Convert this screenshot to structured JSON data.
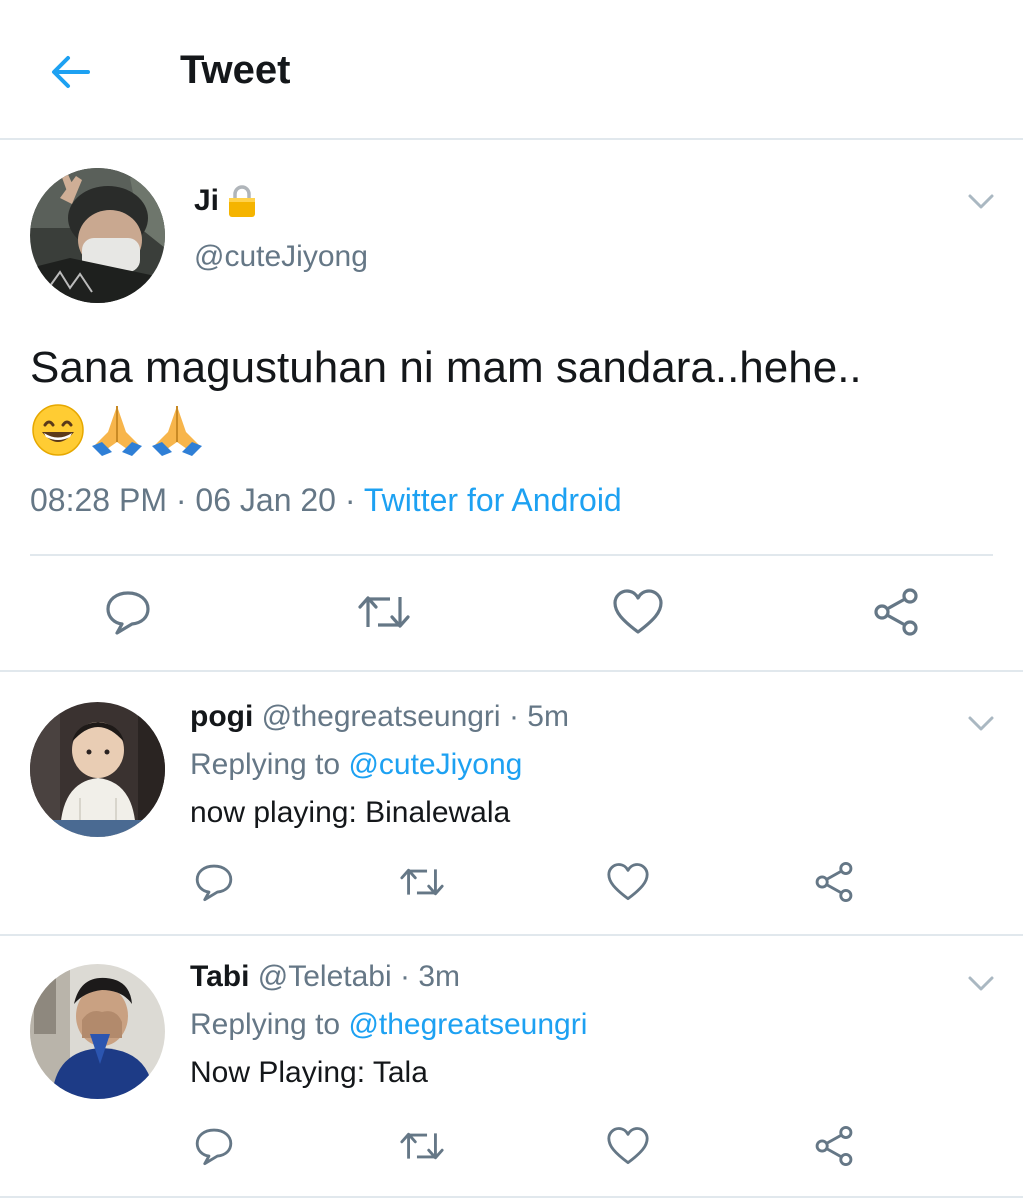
{
  "header": {
    "title": "Tweet",
    "back_icon": "arrow-left-icon"
  },
  "main_tweet": {
    "name": "Ji",
    "name_badge_icon": "lock-icon",
    "handle": "@cuteJiyong",
    "text": "Sana magustuhan ni mam sandara..hehe..",
    "emojis": [
      "grinning-face-emoji",
      "folded-hands-emoji",
      "folded-hands-emoji"
    ],
    "time": "08:28 PM",
    "date": "06 Jan 20",
    "separator": " · ",
    "source": "Twitter for Android",
    "actions": [
      "reply-icon",
      "retweet-icon",
      "like-icon",
      "share-icon"
    ]
  },
  "replies": [
    {
      "name": "pogi",
      "handle": "@thegreatseungri",
      "time": "5m",
      "replying_label": "Replying to",
      "replying_to": "@cuteJiyong",
      "text": "now playing: Binalewala"
    },
    {
      "name": "Tabi",
      "handle": "@Teletabi",
      "time": "3m",
      "replying_label": "Replying to",
      "replying_to": "@thegreatseungri",
      "text": "Now Playing: Tala"
    }
  ],
  "colors": {
    "accent": "#1da1f2",
    "text_primary": "#14171a",
    "text_secondary": "#657786",
    "divider": "#e1e8ed",
    "lock": "#f5b400"
  }
}
